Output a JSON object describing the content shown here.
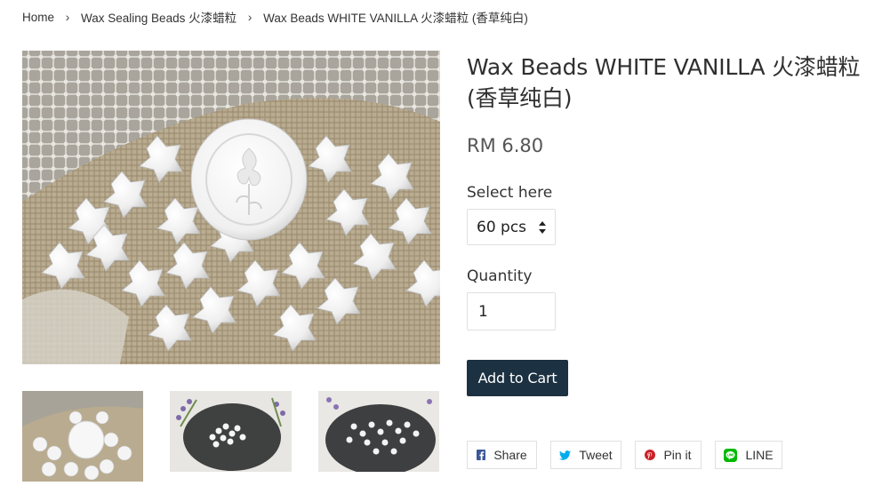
{
  "breadcrumb": {
    "home": "Home",
    "collection": "Wax Sealing Beads 火漆蜡粒",
    "current": "Wax Beads WHITE VANILLA 火漆蜡粒 (香草纯白)",
    "separator": "›"
  },
  "product": {
    "title": "Wax Beads WHITE VANILLA 火漆蜡粒 (香草纯白)",
    "price": "RM 6.80",
    "variant_label": "Select here",
    "variant_selected": "60 pcs",
    "quantity_label": "Quantity",
    "quantity_value": "1",
    "add_to_cart": "Add to Cart"
  },
  "share": [
    {
      "label": "Share",
      "icon": "facebook-icon",
      "color": "#3b5998"
    },
    {
      "label": "Tweet",
      "icon": "twitter-icon",
      "color": "#00aced"
    },
    {
      "label": "Pin it",
      "icon": "pinterest-icon",
      "color": "#cb2027"
    },
    {
      "label": "LINE",
      "icon": "line-icon",
      "color": "#00b900"
    }
  ],
  "colors": {
    "button": "#1c3141",
    "text": "#333333"
  }
}
